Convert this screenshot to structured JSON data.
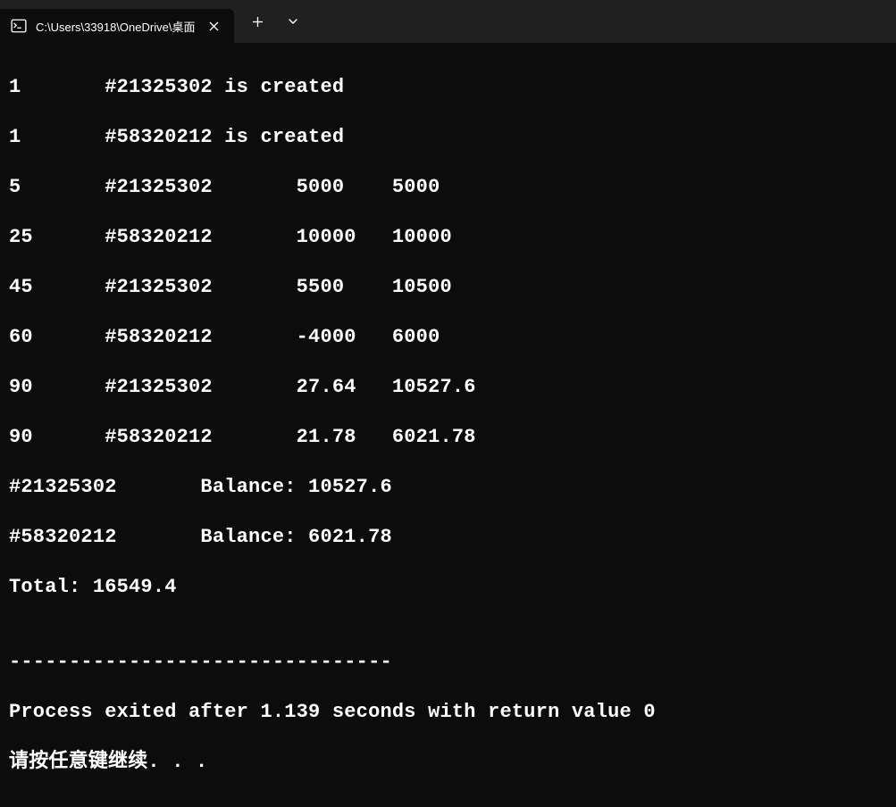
{
  "tab": {
    "title": "C:\\Users\\33918\\OneDrive\\桌面"
  },
  "titlebar": {
    "new_tab": "+",
    "dropdown": "⌄",
    "close": "✕"
  },
  "terminal": {
    "lines": [
      "1       #21325302 is created",
      "1       #58320212 is created",
      "5       #21325302       5000    5000",
      "25      #58320212       10000   10000",
      "45      #21325302       5500    10500",
      "60      #58320212       -4000   6000",
      "90      #21325302       27.64   10527.6",
      "90      #58320212       21.78   6021.78",
      "#21325302       Balance: 10527.6",
      "#58320212       Balance: 6021.78",
      "Total: 16549.4",
      "",
      "--------------------------------",
      "Process exited after 1.139 seconds with return value 0",
      "请按任意键继续. . ."
    ]
  }
}
